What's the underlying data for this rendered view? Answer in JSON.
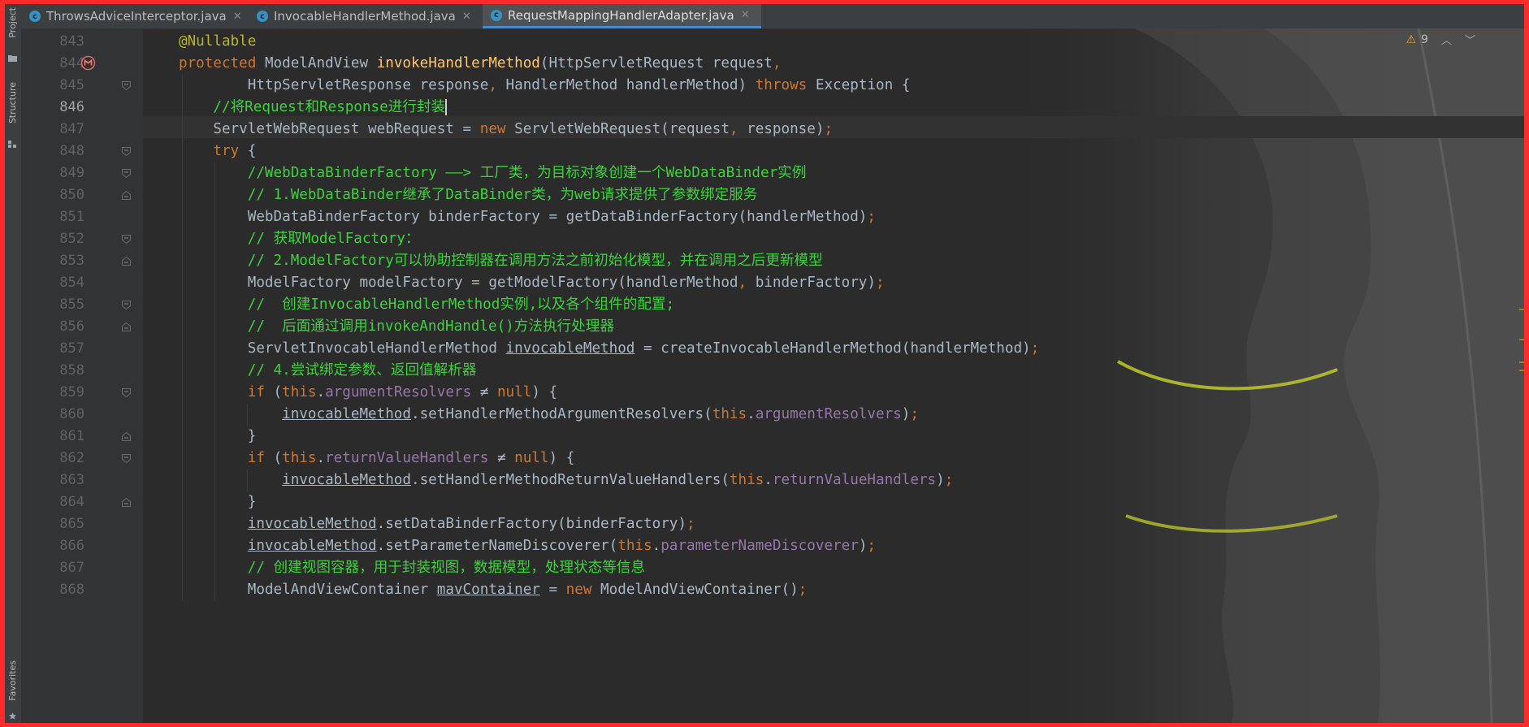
{
  "tabs": [
    {
      "label": "ThrowsAdviceInterceptor.java",
      "icon": "java-class-icon",
      "active": false
    },
    {
      "label": "InvocableHandlerMethod.java",
      "icon": "java-class-icon",
      "active": false
    },
    {
      "label": "RequestMappingHandlerAdapter.java",
      "icon": "java-class-icon",
      "active": true
    }
  ],
  "tool_windows": {
    "project": "Project",
    "structure": "Structure",
    "favorites": "Favorites"
  },
  "inspection": {
    "warning_count": "9",
    "warning_icon": "warning-triangle-icon"
  },
  "editor": {
    "current_line": 846,
    "line_numbers": [
      "843",
      "844",
      "845",
      "846",
      "847",
      "848",
      "849",
      "850",
      "851",
      "852",
      "853",
      "854",
      "855",
      "856",
      "857",
      "858",
      "859",
      "860",
      "861",
      "862",
      "863",
      "864",
      "865",
      "866",
      "867",
      "868"
    ],
    "lines": [
      {
        "n": "843",
        "t": [
          [
            "an",
            "@Nullable"
          ]
        ]
      },
      {
        "n": "844",
        "t": [
          [
            "kw",
            "protected "
          ],
          [
            "",
            "ModelAndView "
          ],
          [
            "fn",
            "invokeHandlerMethod"
          ],
          [
            "",
            "(HttpServletRequest request"
          ],
          [
            "kw",
            ","
          ]
        ]
      },
      {
        "n": "845",
        "t": [
          [
            "",
            "        HttpServletResponse response"
          ],
          [
            "kw",
            ", "
          ],
          [
            "",
            "HandlerMethod handlerMethod) "
          ],
          [
            "kw",
            "throws "
          ],
          [
            "",
            "Exception {"
          ]
        ]
      },
      {
        "n": "846",
        "t": [
          [
            "cm",
            "    //"
          ],
          [
            "cmz",
            "将"
          ],
          [
            "cm",
            "Request"
          ],
          [
            "cmz",
            "和"
          ],
          [
            "cm",
            "Response"
          ],
          [
            "cmz",
            "进行封装"
          ]
        ]
      },
      {
        "n": "847",
        "t": [
          [
            "",
            "    ServletWebRequest webRequest = "
          ],
          [
            "kw",
            "new "
          ],
          [
            "",
            "ServletWebRequest(request"
          ],
          [
            "kw",
            ", "
          ],
          [
            "",
            "response)"
          ],
          [
            "kw",
            ";"
          ]
        ]
      },
      {
        "n": "848",
        "t": [
          [
            "kw",
            "    try "
          ],
          [
            "",
            "{"
          ]
        ]
      },
      {
        "n": "849",
        "t": [
          [
            "cm",
            "        //WebDataBinderFactory ——> "
          ],
          [
            "cmz",
            "工厂类，为目标对象创建一个"
          ],
          [
            "cm",
            "WebDataBinder"
          ],
          [
            "cmz",
            "实例"
          ]
        ]
      },
      {
        "n": "850",
        "t": [
          [
            "cm",
            "        // 1.WebDataBinder"
          ],
          [
            "cmz",
            "继承了"
          ],
          [
            "cm",
            "DataBinder"
          ],
          [
            "cmz",
            "类，为"
          ],
          [
            "cm",
            "web"
          ],
          [
            "cmz",
            "请求提供了参数绑定服务"
          ]
        ]
      },
      {
        "n": "851",
        "t": [
          [
            "",
            "        WebDataBinderFactory binderFactory = getDataBinderFactory(handlerMethod)"
          ],
          [
            "kw",
            ";"
          ]
        ]
      },
      {
        "n": "852",
        "t": [
          [
            "cm",
            "        // "
          ],
          [
            "cmz",
            "获取"
          ],
          [
            "cm",
            "ModelFactory"
          ],
          [
            "cmz",
            "："
          ]
        ]
      },
      {
        "n": "853",
        "t": [
          [
            "cm",
            "        // 2.ModelFactory"
          ],
          [
            "cmz",
            "可以协助控制器在调用方法之前初始化模型，并在调用之后更新模型"
          ]
        ]
      },
      {
        "n": "854",
        "t": [
          [
            "",
            "        ModelFactory modelFactory = getModelFactory(handlerMethod"
          ],
          [
            "kw",
            ", "
          ],
          [
            "",
            "binderFactory)"
          ],
          [
            "kw",
            ";"
          ]
        ]
      },
      {
        "n": "855",
        "t": [
          [
            "cm",
            "        //  "
          ],
          [
            "cmz",
            "创建"
          ],
          [
            "cm",
            "InvocableHandlerMethod"
          ],
          [
            "cmz",
            "实例"
          ],
          [
            "cm",
            ","
          ],
          [
            "cmz",
            "以及各个组件的配置"
          ],
          [
            "cm",
            ";"
          ]
        ]
      },
      {
        "n": "856",
        "t": [
          [
            "cm",
            "        //  "
          ],
          [
            "cmz",
            "后面通过调用"
          ],
          [
            "cm",
            "invokeAndHandle()"
          ],
          [
            "cmz",
            "方法执行处理器"
          ]
        ]
      },
      {
        "n": "857",
        "t": [
          [
            "",
            "        ServletInvocableHandlerMethod "
          ],
          [
            "ul",
            "invocableMethod"
          ],
          [
            "",
            " = createInvocableHandlerMethod(handlerMethod)"
          ],
          [
            "kw",
            ";"
          ]
        ]
      },
      {
        "n": "858",
        "t": [
          [
            "cm",
            "        // 4."
          ],
          [
            "cmz",
            "尝试绑定参数、返回值解析器"
          ]
        ]
      },
      {
        "n": "859",
        "t": [
          [
            "kw",
            "        if "
          ],
          [
            "",
            "("
          ],
          [
            "kw",
            "this"
          ],
          [
            "",
            "."
          ],
          [
            "fd",
            "argumentResolvers"
          ],
          [
            "",
            " ≠ "
          ],
          [
            "kw",
            "null"
          ],
          [
            "",
            ") {"
          ]
        ]
      },
      {
        "n": "860",
        "t": [
          [
            "",
            "            "
          ],
          [
            "ul",
            "invocableMethod"
          ],
          [
            "",
            ".setHandlerMethodArgumentResolvers("
          ],
          [
            "kw",
            "this"
          ],
          [
            "",
            "."
          ],
          [
            "fd",
            "argumentResolvers"
          ],
          [
            "",
            ")"
          ],
          [
            "kw",
            ";"
          ]
        ]
      },
      {
        "n": "861",
        "t": [
          [
            "",
            "        }"
          ]
        ]
      },
      {
        "n": "862",
        "t": [
          [
            "kw",
            "        if "
          ],
          [
            "",
            "("
          ],
          [
            "kw",
            "this"
          ],
          [
            "",
            "."
          ],
          [
            "fd",
            "returnValueHandlers"
          ],
          [
            "",
            " ≠ "
          ],
          [
            "kw",
            "null"
          ],
          [
            "",
            ") {"
          ]
        ]
      },
      {
        "n": "863",
        "t": [
          [
            "",
            "            "
          ],
          [
            "ul",
            "invocableMethod"
          ],
          [
            "",
            ".setHandlerMethodReturnValueHandlers("
          ],
          [
            "kw",
            "this"
          ],
          [
            "",
            "."
          ],
          [
            "fd",
            "returnValueHandlers"
          ],
          [
            "",
            ")"
          ],
          [
            "kw",
            ";"
          ]
        ]
      },
      {
        "n": "864",
        "t": [
          [
            "",
            "        }"
          ]
        ]
      },
      {
        "n": "865",
        "t": [
          [
            "",
            "        "
          ],
          [
            "ul",
            "invocableMethod"
          ],
          [
            "",
            ".setDataBinderFactory(binderFactory)"
          ],
          [
            "kw",
            ";"
          ]
        ]
      },
      {
        "n": "866",
        "t": [
          [
            "",
            "        "
          ],
          [
            "ul",
            "invocableMethod"
          ],
          [
            "",
            ".setParameterNameDiscoverer("
          ],
          [
            "kw",
            "this"
          ],
          [
            "",
            "."
          ],
          [
            "fd",
            "parameterNameDiscoverer"
          ],
          [
            "",
            ")"
          ],
          [
            "kw",
            ";"
          ]
        ]
      },
      {
        "n": "867",
        "t": [
          [
            "cm",
            "        // "
          ],
          [
            "cmz",
            "创建视图容器，用于封装视图，数据模型，处理状态等信息"
          ]
        ]
      },
      {
        "n": "868",
        "t": [
          [
            "",
            "        ModelAndViewContainer "
          ],
          [
            "ul",
            "mavContainer"
          ],
          [
            "",
            " = "
          ],
          [
            "kw",
            "new "
          ],
          [
            "",
            "ModelAndViewContainer()"
          ],
          [
            "kw",
            ";"
          ]
        ]
      }
    ]
  },
  "gutter_icons": {
    "override_marker": "override-method-icon",
    "fold_marker": "fold-toggle-icon"
  },
  "colors": {
    "frame": "#ff2a2a",
    "editor_bg": "#2b2b2b",
    "keyword": "#cc7832",
    "annotation": "#bbb529",
    "method_decl": "#ffc66d",
    "field": "#9876aa",
    "comment": "#3fd13f",
    "plain": "#a9b7c6"
  }
}
